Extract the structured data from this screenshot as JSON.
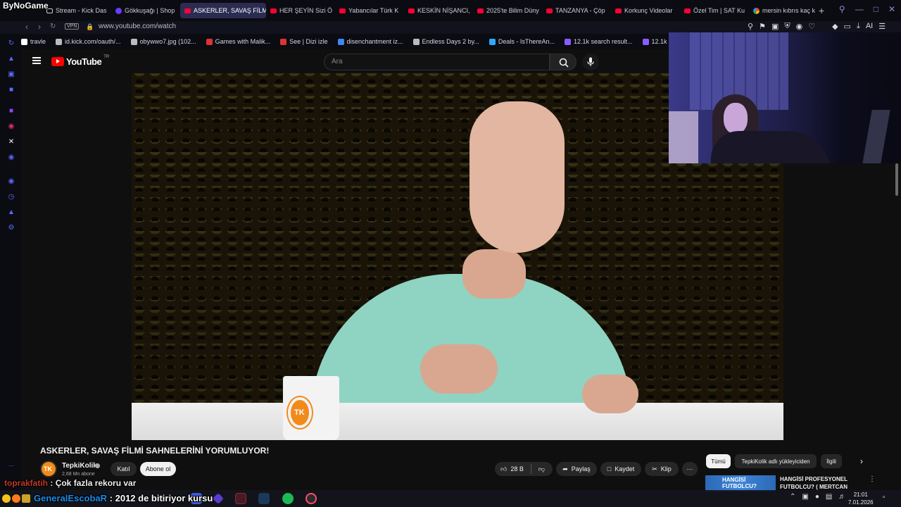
{
  "overlay": {
    "brand": "ByNoGame"
  },
  "browser": {
    "tabs": [
      {
        "label": "Stream - Kick Das",
        "icon": "green-icon"
      },
      {
        "label": "Gökkuşağı | Shop",
        "icon": "purple-icon"
      },
      {
        "label": "ASKERLER, SAVAŞ FİLMİ",
        "icon": "youtube-icon",
        "active": true
      },
      {
        "label": "HER ŞEYİN Sizi Ö",
        "icon": "youtube-icon"
      },
      {
        "label": "Yabancılar Türk K",
        "icon": "youtube-icon"
      },
      {
        "label": "KESKİN NİŞANCI,",
        "icon": "youtube-icon"
      },
      {
        "label": "2025'te Bilim Düny",
        "icon": "youtube-icon"
      },
      {
        "label": "TANZANYA - Çöp",
        "icon": "youtube-icon"
      },
      {
        "label": "Korkunç Videolar",
        "icon": "youtube-icon"
      },
      {
        "label": "Özel Tim | SAT Ku",
        "icon": "youtube-icon"
      },
      {
        "label": "mersin kıbrıs kaç k",
        "icon": "google-icon"
      }
    ],
    "new_tab": "+",
    "vpn_label": "VPN",
    "url": "www.youtube.com/watch",
    "ai_label": "AI",
    "bookmarks": [
      "travle",
      "id.kick.com/oauth/...",
      "obywwo7.jpg (102...",
      "Games with Malik...",
      "See | Dizi izle",
      "disenchantment iz...",
      "Endless Days 2 by...",
      "Deals - IsThereAn...",
      "12.1k search result...",
      "12.1k search res"
    ]
  },
  "youtube": {
    "logo_text": "YouTube",
    "logo_region": "TR",
    "search_placeholder": "Ara",
    "video_title": "ASKERLER, SAVAŞ FİLMİ SAHNELERİNİ YORUMLUYOR!",
    "mug_logo": "TK",
    "channel": {
      "avatar_text": "TK",
      "name": "TepkiKolik",
      "subscribers": "2,68 Mn abone",
      "join_label": "Katıl",
      "subscribe_label": "Abone ol"
    },
    "actions": {
      "likes": "28 B",
      "share": "Paylaş",
      "save": "Kaydet",
      "clip": "Klip"
    },
    "chips": [
      "Tümü",
      "TepkiKolik adlı yükleyiciden",
      "İlgili"
    ],
    "related": {
      "thumb_text": "HANGİSİ FUTBOLCU?",
      "title": "HANGİSİ PROFESYONEL FUTBOLCU? ( MERTCAN"
    }
  },
  "stream_chat": [
    {
      "user": "toprakfatih",
      "message": ": Çok fazla rekoru var"
    },
    {
      "user": "GeneralEscobaR",
      "message": ": 2012 de bitiriyor kursu"
    }
  ],
  "taskbar": {
    "time": "21:01",
    "date": "7.01.2026"
  }
}
